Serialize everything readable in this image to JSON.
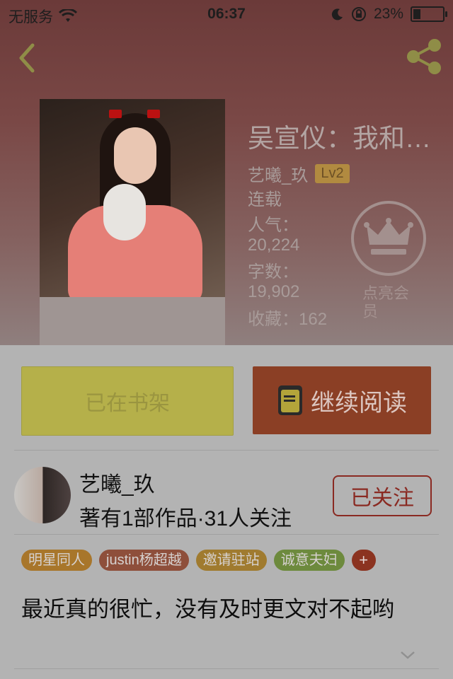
{
  "status_bar": {
    "carrier": "无服务",
    "time": "06:37",
    "battery": "23%"
  },
  "book": {
    "title": "吴宣仪：我和…",
    "author": "艺曦_玖",
    "level": "Lv2",
    "status": "连载",
    "popularity_label": "人气：",
    "popularity": "20,224",
    "word_count_label": "字数：",
    "word_count": "19,902",
    "favorites": "收藏：162"
  },
  "vip": {
    "label": "点亮会员"
  },
  "actions": {
    "on_shelf": "已在书架",
    "continue_reading": "继续阅读"
  },
  "author_panel": {
    "name": "艺曦_玖",
    "stats": "著有1部作品·31人关注",
    "follow": "已关注"
  },
  "tags": [
    {
      "label": "明星同人",
      "color": "#a8762b"
    },
    {
      "label": "justin杨超越",
      "color": "#8e4f3b"
    },
    {
      "label": "邀请驻站",
      "color": "#a07b2f"
    },
    {
      "label": "诚意夫妇",
      "color": "#6d8a3d"
    }
  ],
  "tag_add": "+",
  "description": "最近真的很忙，没有及时更文对不起哟",
  "colors": {
    "shelf_button": "#b5b04a",
    "read_button": "#8b3f25",
    "follow_border": "#8a2a22"
  }
}
